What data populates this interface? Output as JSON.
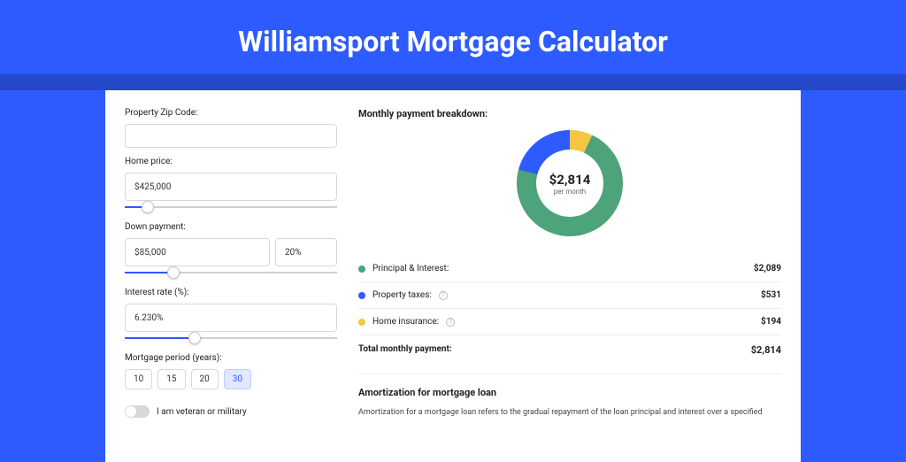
{
  "page_title": "Williamsport Mortgage Calculator",
  "form": {
    "zip_label": "Property Zip Code:",
    "zip_value": "",
    "home_price_label": "Home price:",
    "home_price_value": "$425,000",
    "down_payment_label": "Down payment:",
    "down_payment_value": "$85,000",
    "down_payment_pct": "20%",
    "interest_rate_label": "Interest rate (%):",
    "interest_rate_value": "6.230%",
    "period_label": "Mortgage period (years):",
    "periods": [
      "10",
      "15",
      "20",
      "30"
    ],
    "period_selected": "30",
    "veteran_label": "I am veteran or military"
  },
  "breakdown": {
    "title": "Monthly payment breakdown:",
    "center_value": "$2,814",
    "center_label": "per month",
    "items": [
      {
        "label": "Principal & Interest:",
        "value": "$2,089",
        "color": "g",
        "info": false
      },
      {
        "label": "Property taxes:",
        "value": "$531",
        "color": "b",
        "info": true
      },
      {
        "label": "Home insurance:",
        "value": "$194",
        "color": "y",
        "info": true
      }
    ],
    "total_label": "Total monthly payment:",
    "total_value": "$2,814"
  },
  "amortization": {
    "title": "Amortization for mortgage loan",
    "text": "Amortization for a mortgage loan refers to the gradual repayment of the loan principal and interest over a specified"
  },
  "chart_data": {
    "type": "pie",
    "title": "Monthly payment breakdown",
    "series": [
      {
        "name": "Principal & Interest",
        "value": 2089,
        "color": "#4da37a"
      },
      {
        "name": "Property taxes",
        "value": 531,
        "color": "#2d5bff"
      },
      {
        "name": "Home insurance",
        "value": 194,
        "color": "#f2c744"
      }
    ],
    "total": 2814
  }
}
